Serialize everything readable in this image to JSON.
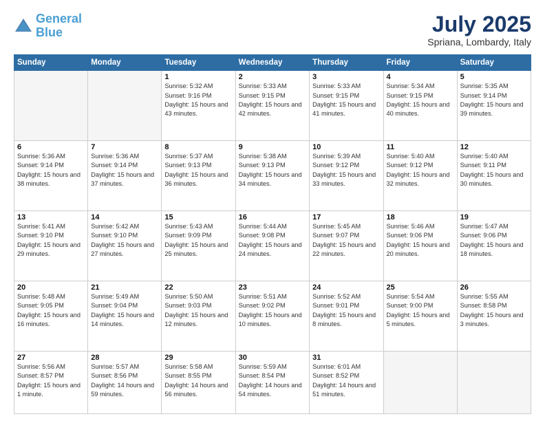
{
  "header": {
    "logo_line1": "General",
    "logo_line2": "Blue",
    "month": "July 2025",
    "location": "Spriana, Lombardy, Italy"
  },
  "weekdays": [
    "Sunday",
    "Monday",
    "Tuesday",
    "Wednesday",
    "Thursday",
    "Friday",
    "Saturday"
  ],
  "weeks": [
    [
      {
        "day": "",
        "sunrise": "",
        "sunset": "",
        "daylight": ""
      },
      {
        "day": "",
        "sunrise": "",
        "sunset": "",
        "daylight": ""
      },
      {
        "day": "1",
        "sunrise": "Sunrise: 5:32 AM",
        "sunset": "Sunset: 9:16 PM",
        "daylight": "Daylight: 15 hours and 43 minutes."
      },
      {
        "day": "2",
        "sunrise": "Sunrise: 5:33 AM",
        "sunset": "Sunset: 9:15 PM",
        "daylight": "Daylight: 15 hours and 42 minutes."
      },
      {
        "day": "3",
        "sunrise": "Sunrise: 5:33 AM",
        "sunset": "Sunset: 9:15 PM",
        "daylight": "Daylight: 15 hours and 41 minutes."
      },
      {
        "day": "4",
        "sunrise": "Sunrise: 5:34 AM",
        "sunset": "Sunset: 9:15 PM",
        "daylight": "Daylight: 15 hours and 40 minutes."
      },
      {
        "day": "5",
        "sunrise": "Sunrise: 5:35 AM",
        "sunset": "Sunset: 9:14 PM",
        "daylight": "Daylight: 15 hours and 39 minutes."
      }
    ],
    [
      {
        "day": "6",
        "sunrise": "Sunrise: 5:36 AM",
        "sunset": "Sunset: 9:14 PM",
        "daylight": "Daylight: 15 hours and 38 minutes."
      },
      {
        "day": "7",
        "sunrise": "Sunrise: 5:36 AM",
        "sunset": "Sunset: 9:14 PM",
        "daylight": "Daylight: 15 hours and 37 minutes."
      },
      {
        "day": "8",
        "sunrise": "Sunrise: 5:37 AM",
        "sunset": "Sunset: 9:13 PM",
        "daylight": "Daylight: 15 hours and 36 minutes."
      },
      {
        "day": "9",
        "sunrise": "Sunrise: 5:38 AM",
        "sunset": "Sunset: 9:13 PM",
        "daylight": "Daylight: 15 hours and 34 minutes."
      },
      {
        "day": "10",
        "sunrise": "Sunrise: 5:39 AM",
        "sunset": "Sunset: 9:12 PM",
        "daylight": "Daylight: 15 hours and 33 minutes."
      },
      {
        "day": "11",
        "sunrise": "Sunrise: 5:40 AM",
        "sunset": "Sunset: 9:12 PM",
        "daylight": "Daylight: 15 hours and 32 minutes."
      },
      {
        "day": "12",
        "sunrise": "Sunrise: 5:40 AM",
        "sunset": "Sunset: 9:11 PM",
        "daylight": "Daylight: 15 hours and 30 minutes."
      }
    ],
    [
      {
        "day": "13",
        "sunrise": "Sunrise: 5:41 AM",
        "sunset": "Sunset: 9:10 PM",
        "daylight": "Daylight: 15 hours and 29 minutes."
      },
      {
        "day": "14",
        "sunrise": "Sunrise: 5:42 AM",
        "sunset": "Sunset: 9:10 PM",
        "daylight": "Daylight: 15 hours and 27 minutes."
      },
      {
        "day": "15",
        "sunrise": "Sunrise: 5:43 AM",
        "sunset": "Sunset: 9:09 PM",
        "daylight": "Daylight: 15 hours and 25 minutes."
      },
      {
        "day": "16",
        "sunrise": "Sunrise: 5:44 AM",
        "sunset": "Sunset: 9:08 PM",
        "daylight": "Daylight: 15 hours and 24 minutes."
      },
      {
        "day": "17",
        "sunrise": "Sunrise: 5:45 AM",
        "sunset": "Sunset: 9:07 PM",
        "daylight": "Daylight: 15 hours and 22 minutes."
      },
      {
        "day": "18",
        "sunrise": "Sunrise: 5:46 AM",
        "sunset": "Sunset: 9:06 PM",
        "daylight": "Daylight: 15 hours and 20 minutes."
      },
      {
        "day": "19",
        "sunrise": "Sunrise: 5:47 AM",
        "sunset": "Sunset: 9:06 PM",
        "daylight": "Daylight: 15 hours and 18 minutes."
      }
    ],
    [
      {
        "day": "20",
        "sunrise": "Sunrise: 5:48 AM",
        "sunset": "Sunset: 9:05 PM",
        "daylight": "Daylight: 15 hours and 16 minutes."
      },
      {
        "day": "21",
        "sunrise": "Sunrise: 5:49 AM",
        "sunset": "Sunset: 9:04 PM",
        "daylight": "Daylight: 15 hours and 14 minutes."
      },
      {
        "day": "22",
        "sunrise": "Sunrise: 5:50 AM",
        "sunset": "Sunset: 9:03 PM",
        "daylight": "Daylight: 15 hours and 12 minutes."
      },
      {
        "day": "23",
        "sunrise": "Sunrise: 5:51 AM",
        "sunset": "Sunset: 9:02 PM",
        "daylight": "Daylight: 15 hours and 10 minutes."
      },
      {
        "day": "24",
        "sunrise": "Sunrise: 5:52 AM",
        "sunset": "Sunset: 9:01 PM",
        "daylight": "Daylight: 15 hours and 8 minutes."
      },
      {
        "day": "25",
        "sunrise": "Sunrise: 5:54 AM",
        "sunset": "Sunset: 9:00 PM",
        "daylight": "Daylight: 15 hours and 5 minutes."
      },
      {
        "day": "26",
        "sunrise": "Sunrise: 5:55 AM",
        "sunset": "Sunset: 8:58 PM",
        "daylight": "Daylight: 15 hours and 3 minutes."
      }
    ],
    [
      {
        "day": "27",
        "sunrise": "Sunrise: 5:56 AM",
        "sunset": "Sunset: 8:57 PM",
        "daylight": "Daylight: 15 hours and 1 minute."
      },
      {
        "day": "28",
        "sunrise": "Sunrise: 5:57 AM",
        "sunset": "Sunset: 8:56 PM",
        "daylight": "Daylight: 14 hours and 59 minutes."
      },
      {
        "day": "29",
        "sunrise": "Sunrise: 5:58 AM",
        "sunset": "Sunset: 8:55 PM",
        "daylight": "Daylight: 14 hours and 56 minutes."
      },
      {
        "day": "30",
        "sunrise": "Sunrise: 5:59 AM",
        "sunset": "Sunset: 8:54 PM",
        "daylight": "Daylight: 14 hours and 54 minutes."
      },
      {
        "day": "31",
        "sunrise": "Sunrise: 6:01 AM",
        "sunset": "Sunset: 8:52 PM",
        "daylight": "Daylight: 14 hours and 51 minutes."
      },
      {
        "day": "",
        "sunrise": "",
        "sunset": "",
        "daylight": ""
      },
      {
        "day": "",
        "sunrise": "",
        "sunset": "",
        "daylight": ""
      }
    ]
  ]
}
